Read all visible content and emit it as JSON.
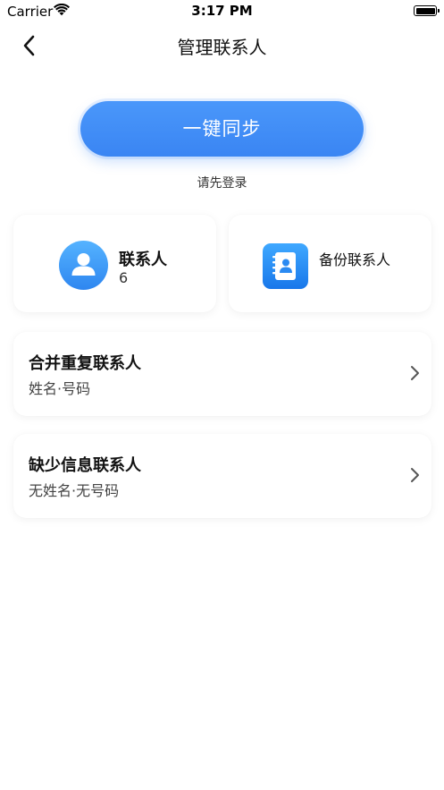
{
  "status_bar": {
    "carrier": "Carrier",
    "time": "3:17 PM",
    "wifi_icon": "wifi-icon",
    "battery_icon": "battery-icon"
  },
  "nav": {
    "back_icon": "chevron-left-icon",
    "title": "管理联系人"
  },
  "sync": {
    "button_label": "一键同步",
    "hint": "请先登录"
  },
  "cards": {
    "contacts": {
      "icon": "person-icon",
      "label": "联系人",
      "count": "6"
    },
    "backup": {
      "icon": "address-book-icon",
      "label": "备份联系人"
    }
  },
  "rows": [
    {
      "title": "合并重复联系人",
      "subtitle": "姓名·号码",
      "icon": "chevron-right-icon"
    },
    {
      "title": "缺少信息联系人",
      "subtitle": "无姓名·无号码",
      "icon": "chevron-right-icon"
    }
  ],
  "colors": {
    "accent": "#3a85f3",
    "accent_light": "#4a97fa",
    "icon_blue": "#2e86f0",
    "card_shadow": "#e9edf3"
  }
}
